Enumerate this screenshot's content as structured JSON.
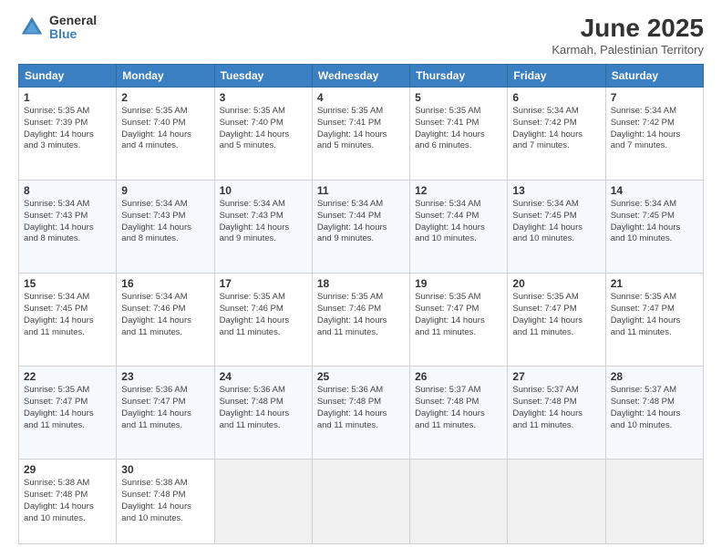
{
  "logo": {
    "general": "General",
    "blue": "Blue"
  },
  "title": {
    "month": "June 2025",
    "location": "Karmah, Palestinian Territory"
  },
  "headers": [
    "Sunday",
    "Monday",
    "Tuesday",
    "Wednesday",
    "Thursday",
    "Friday",
    "Saturday"
  ],
  "weeks": [
    [
      {
        "day": "1",
        "info": "Sunrise: 5:35 AM\nSunset: 7:39 PM\nDaylight: 14 hours\nand 3 minutes."
      },
      {
        "day": "2",
        "info": "Sunrise: 5:35 AM\nSunset: 7:40 PM\nDaylight: 14 hours\nand 4 minutes."
      },
      {
        "day": "3",
        "info": "Sunrise: 5:35 AM\nSunset: 7:40 PM\nDaylight: 14 hours\nand 5 minutes."
      },
      {
        "day": "4",
        "info": "Sunrise: 5:35 AM\nSunset: 7:41 PM\nDaylight: 14 hours\nand 5 minutes."
      },
      {
        "day": "5",
        "info": "Sunrise: 5:35 AM\nSunset: 7:41 PM\nDaylight: 14 hours\nand 6 minutes."
      },
      {
        "day": "6",
        "info": "Sunrise: 5:34 AM\nSunset: 7:42 PM\nDaylight: 14 hours\nand 7 minutes."
      },
      {
        "day": "7",
        "info": "Sunrise: 5:34 AM\nSunset: 7:42 PM\nDaylight: 14 hours\nand 7 minutes."
      }
    ],
    [
      {
        "day": "8",
        "info": "Sunrise: 5:34 AM\nSunset: 7:43 PM\nDaylight: 14 hours\nand 8 minutes."
      },
      {
        "day": "9",
        "info": "Sunrise: 5:34 AM\nSunset: 7:43 PM\nDaylight: 14 hours\nand 8 minutes."
      },
      {
        "day": "10",
        "info": "Sunrise: 5:34 AM\nSunset: 7:43 PM\nDaylight: 14 hours\nand 9 minutes."
      },
      {
        "day": "11",
        "info": "Sunrise: 5:34 AM\nSunset: 7:44 PM\nDaylight: 14 hours\nand 9 minutes."
      },
      {
        "day": "12",
        "info": "Sunrise: 5:34 AM\nSunset: 7:44 PM\nDaylight: 14 hours\nand 10 minutes."
      },
      {
        "day": "13",
        "info": "Sunrise: 5:34 AM\nSunset: 7:45 PM\nDaylight: 14 hours\nand 10 minutes."
      },
      {
        "day": "14",
        "info": "Sunrise: 5:34 AM\nSunset: 7:45 PM\nDaylight: 14 hours\nand 10 minutes."
      }
    ],
    [
      {
        "day": "15",
        "info": "Sunrise: 5:34 AM\nSunset: 7:45 PM\nDaylight: 14 hours\nand 11 minutes."
      },
      {
        "day": "16",
        "info": "Sunrise: 5:34 AM\nSunset: 7:46 PM\nDaylight: 14 hours\nand 11 minutes."
      },
      {
        "day": "17",
        "info": "Sunrise: 5:35 AM\nSunset: 7:46 PM\nDaylight: 14 hours\nand 11 minutes."
      },
      {
        "day": "18",
        "info": "Sunrise: 5:35 AM\nSunset: 7:46 PM\nDaylight: 14 hours\nand 11 minutes."
      },
      {
        "day": "19",
        "info": "Sunrise: 5:35 AM\nSunset: 7:47 PM\nDaylight: 14 hours\nand 11 minutes."
      },
      {
        "day": "20",
        "info": "Sunrise: 5:35 AM\nSunset: 7:47 PM\nDaylight: 14 hours\nand 11 minutes."
      },
      {
        "day": "21",
        "info": "Sunrise: 5:35 AM\nSunset: 7:47 PM\nDaylight: 14 hours\nand 11 minutes."
      }
    ],
    [
      {
        "day": "22",
        "info": "Sunrise: 5:35 AM\nSunset: 7:47 PM\nDaylight: 14 hours\nand 11 minutes."
      },
      {
        "day": "23",
        "info": "Sunrise: 5:36 AM\nSunset: 7:47 PM\nDaylight: 14 hours\nand 11 minutes."
      },
      {
        "day": "24",
        "info": "Sunrise: 5:36 AM\nSunset: 7:48 PM\nDaylight: 14 hours\nand 11 minutes."
      },
      {
        "day": "25",
        "info": "Sunrise: 5:36 AM\nSunset: 7:48 PM\nDaylight: 14 hours\nand 11 minutes."
      },
      {
        "day": "26",
        "info": "Sunrise: 5:37 AM\nSunset: 7:48 PM\nDaylight: 14 hours\nand 11 minutes."
      },
      {
        "day": "27",
        "info": "Sunrise: 5:37 AM\nSunset: 7:48 PM\nDaylight: 14 hours\nand 11 minutes."
      },
      {
        "day": "28",
        "info": "Sunrise: 5:37 AM\nSunset: 7:48 PM\nDaylight: 14 hours\nand 10 minutes."
      }
    ],
    [
      {
        "day": "29",
        "info": "Sunrise: 5:38 AM\nSunset: 7:48 PM\nDaylight: 14 hours\nand 10 minutes."
      },
      {
        "day": "30",
        "info": "Sunrise: 5:38 AM\nSunset: 7:48 PM\nDaylight: 14 hours\nand 10 minutes."
      },
      {
        "day": "",
        "info": ""
      },
      {
        "day": "",
        "info": ""
      },
      {
        "day": "",
        "info": ""
      },
      {
        "day": "",
        "info": ""
      },
      {
        "day": "",
        "info": ""
      }
    ]
  ]
}
